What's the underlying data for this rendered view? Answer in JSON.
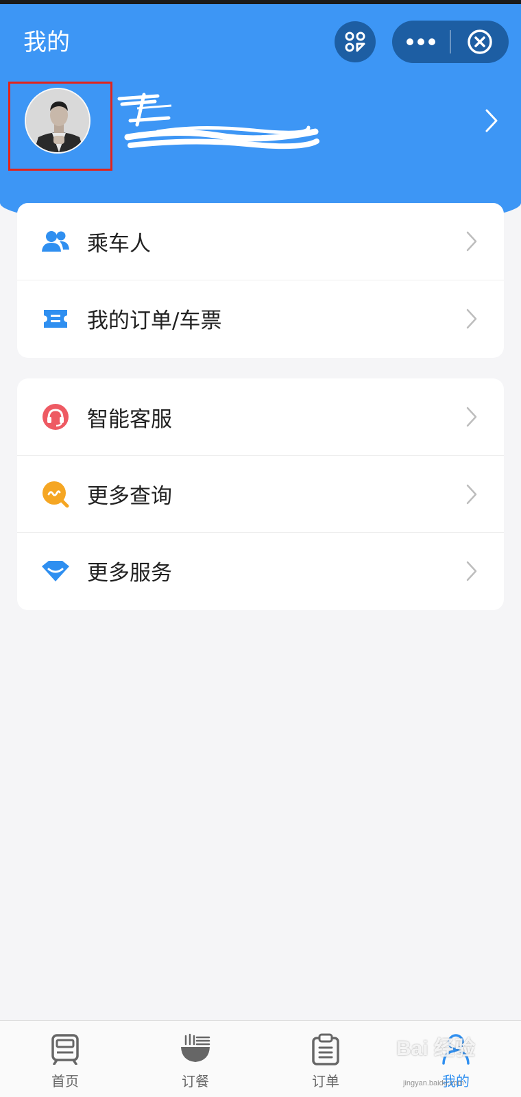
{
  "header": {
    "title": "我的",
    "background_color": "#3d96f5",
    "capsule_color": "#1d5ea3",
    "scan_icon": "qr-scan-icon",
    "more_icon": "more-dots-icon",
    "close_icon": "close-circle-icon"
  },
  "profile": {
    "avatar": "user-avatar",
    "highlight_color": "#e2231a",
    "chevron_icon": "chevron-right-icon"
  },
  "menu_groups": [
    [
      {
        "label": "乘车人",
        "icon": "passengers-icon",
        "icon_color": "#2f8ff0"
      },
      {
        "label": "我的订单/车票",
        "icon": "ticket-icon",
        "icon_color": "#2f8ff0"
      }
    ],
    [
      {
        "label": "智能客服",
        "icon": "headset-service-icon",
        "icon_color": "#ee5a63"
      },
      {
        "label": "更多查询",
        "icon": "search-chat-icon",
        "icon_color": "#f5a623"
      },
      {
        "label": "更多服务",
        "icon": "diamond-service-icon",
        "icon_color": "#2f8ff0"
      }
    ]
  ],
  "tabbar": {
    "tabs": [
      {
        "label": "首页",
        "icon": "train-icon",
        "active": false
      },
      {
        "label": "订餐",
        "icon": "meal-bowl-icon",
        "active": false
      },
      {
        "label": "订单",
        "icon": "clipboard-icon",
        "active": false
      },
      {
        "label": "我的",
        "icon": "person-icon",
        "active": true
      }
    ],
    "active_color": "#2f8ff0"
  },
  "watermark": {
    "logo": "Bai 经验",
    "url": "jingyan.baidu.com"
  }
}
